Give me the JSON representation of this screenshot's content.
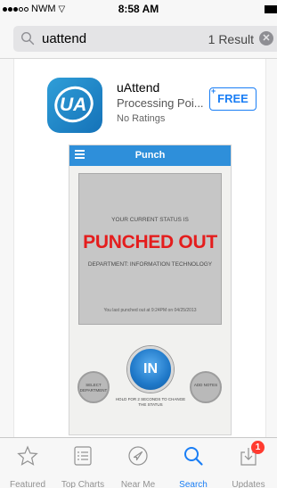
{
  "status_bar": {
    "carrier": "NWM",
    "time": "8:58 AM"
  },
  "search": {
    "query": "uattend",
    "result_count": "1 Result"
  },
  "result": {
    "app_name": "uAttend",
    "app_subtitle": "Processing Poi...",
    "ratings": "No Ratings",
    "price_button": "FREE",
    "icon_letters": "UA",
    "screenshot": {
      "header_title": "Punch",
      "status_label": "YOUR CURRENT STATUS IS",
      "status_value": "PUNCHED OUT",
      "department": "DEPARTMENT: INFORMATION TECHNOLOGY",
      "last_punch": "You last punched out at 9:24PM on 04/25/2013",
      "select_department": "SELECT DEPARTMENT",
      "add_notes": "ADD NOTES",
      "in_button": "IN",
      "hold_text": "HOLD FOR 2 SECONDS TO CHANGE THE STATUS"
    }
  },
  "tab_bar": {
    "tabs": [
      {
        "label": "Featured",
        "icon": "star-icon",
        "active": false
      },
      {
        "label": "Top Charts",
        "icon": "list-icon",
        "active": false
      },
      {
        "label": "Near Me",
        "icon": "location-arrow-icon",
        "active": false
      },
      {
        "label": "Search",
        "icon": "search-icon",
        "active": true
      },
      {
        "label": "Updates",
        "icon": "download-tray-icon",
        "active": false,
        "badge": "1"
      }
    ]
  },
  "colors": {
    "accent": "#1a7ef5",
    "status_red": "#e41d1d",
    "badge_red": "#ff3b30",
    "app_blue": "#2e8fda"
  }
}
